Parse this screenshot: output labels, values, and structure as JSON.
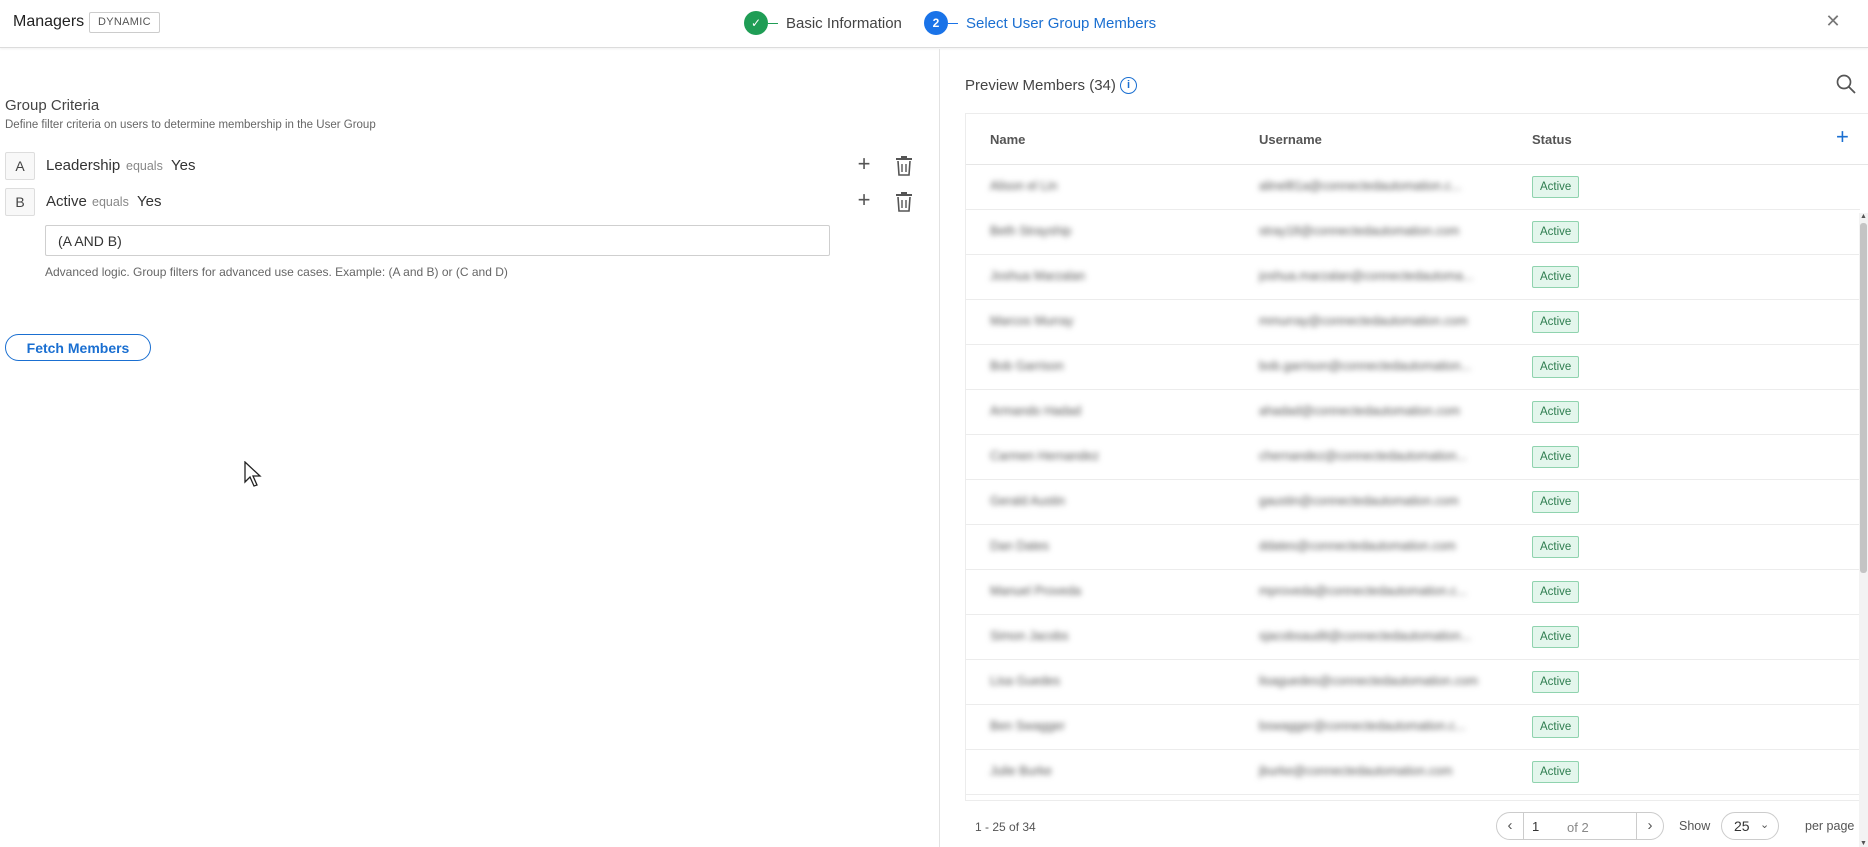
{
  "header": {
    "title": "Managers",
    "badge": "DYNAMIC",
    "steps": [
      {
        "number": "✓",
        "label": "Basic Information",
        "state": "complete"
      },
      {
        "number": "2",
        "label": "Select User Group Members",
        "state": "active"
      }
    ],
    "close_icon": "close-icon"
  },
  "criteria": {
    "title": "Group Criteria",
    "description": "Define filter criteria on users to determine membership in the User Group",
    "rows": [
      {
        "letter": "A",
        "field": "Leadership",
        "operator": "equals",
        "value": "Yes"
      },
      {
        "letter": "B",
        "field": "Active",
        "operator": "equals",
        "value": "Yes"
      }
    ],
    "logic_value": "(A AND B)",
    "logic_help": "Advanced logic. Group filters for advanced use cases. Example: (A and B) or (C and D)",
    "fetch_label": "Fetch Members"
  },
  "preview": {
    "title": "Preview Members (34)",
    "columns": [
      "Name",
      "Username",
      "Status"
    ],
    "rows": [
      {
        "name": "Alison el Lin",
        "username": "alinel81a@connectedautomation.c...",
        "status": "Active"
      },
      {
        "name": "Beth Strayship",
        "username": "stray18@connectedautomation.com",
        "status": "Active"
      },
      {
        "name": "Joshua Marzalan",
        "username": "joshua.marzalan@connectedautoma...",
        "status": "Active"
      },
      {
        "name": "Marcos Murray",
        "username": "mmurray@connectedautomation.com",
        "status": "Active"
      },
      {
        "name": "Bob Garrison",
        "username": "bob.garrison@connectedautomation...",
        "status": "Active"
      },
      {
        "name": "Armando Hadad",
        "username": "ahadad@connectedautomation.com",
        "status": "Active"
      },
      {
        "name": "Carmen Hernandez",
        "username": "chernandez@connectedautomation...",
        "status": "Active"
      },
      {
        "name": "Gerald Austin",
        "username": "gaustin@connectedautomation.com",
        "status": "Active"
      },
      {
        "name": "Dan Dates",
        "username": "ddates@connectedautomation.com",
        "status": "Active"
      },
      {
        "name": "Manuel Proveda",
        "username": "mproveda@connectedautomation.c...",
        "status": "Active"
      },
      {
        "name": "Simon Jacobs",
        "username": "sjacobsaudit@connectedautomation...",
        "status": "Active"
      },
      {
        "name": "Lisa Guedes",
        "username": "lisaguedes@connectedautomation.com",
        "status": "Active"
      },
      {
        "name": "Ben Swagger",
        "username": "bswagger@connectedautomation.c...",
        "status": "Active"
      },
      {
        "name": "Julie Burke",
        "username": "jburke@connectedautomation.com",
        "status": "Active"
      }
    ],
    "status_color": "#2e7d4f",
    "footer": {
      "range": "1 - 25 of 34",
      "page": "1",
      "of_pages": "of 2",
      "show_label": "Show",
      "per_page": "25",
      "per_page_label": "per page"
    }
  },
  "colors": {
    "accent": "#1a6fd1",
    "success": "#1f9d55"
  }
}
